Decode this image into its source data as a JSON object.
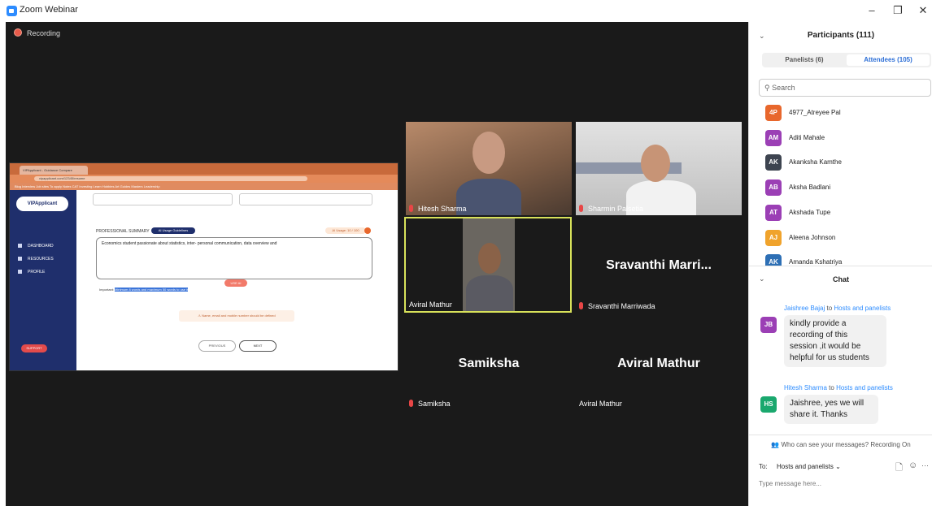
{
  "window": {
    "title": "Zoom Webinar",
    "controls": {
      "minimize": "–",
      "maximize": "❐",
      "close": "✕"
    }
  },
  "recording": {
    "label": "Recording"
  },
  "shared_screen": {
    "tab_title": "VIPApplicant - Guidance Compare",
    "url": "vipapplicant.com/12345/resume",
    "bookmarks": "Blog   Interview   Job sites   To apply   Notes   CAT   Investing   Learn   Hobbies   Art   Guides   Masters   Leadership",
    "sidebar_logo": "VIPApplicant",
    "sidebar_items": [
      "DASHBOARD",
      "RESOURCES",
      "PROFILE"
    ],
    "support_label": "SUPPORT",
    "section_label": "PROFESSIONAL SUMMARY",
    "ai_badge": "AI Usage Guidelines",
    "ai_usage": "AI Usage: 10 / 100",
    "textarea_text": "Economics student passionate about statistics, inter- personal communication, data overview and",
    "ai_button": "USE AI",
    "important_label": "Important:",
    "important_text": "Minimum 8 words and maximum 50 words to use it",
    "warning_text": "Name, email and mobile number should be defined",
    "prev_button": "PREVIOUS",
    "next_button": "NEXT"
  },
  "video_tiles": [
    {
      "name": "Hitesh Sharma",
      "muted": true
    },
    {
      "name": "Sharmin Palsetia",
      "muted": true
    },
    {
      "name": "Aviral Mathur",
      "muted": false
    },
    {
      "name": "Sravanthi Marriwada",
      "display": "Sravanthi  Marri...",
      "muted": true
    },
    {
      "name": "Samiksha",
      "display": "Samiksha",
      "muted": true
    },
    {
      "name": "Aviral Mathur",
      "display": "Aviral Mathur",
      "muted": false
    }
  ],
  "participants": {
    "header": "Participants (111)",
    "tab_panelists": "Panelists (6)",
    "tab_attendees": "Attendees (105)",
    "search_placeholder": "Search",
    "list": [
      {
        "initials": "4P",
        "name": "4977_Atreyee Pal",
        "color": "#e8672c"
      },
      {
        "initials": "AM",
        "name": "Aditi Mahale",
        "color": "#9b3fb5"
      },
      {
        "initials": "AK",
        "name": "Akanksha Kamthe",
        "color": "#3d4450"
      },
      {
        "initials": "AB",
        "name": "Aksha Badlani",
        "color": "#9b3fb5"
      },
      {
        "initials": "AT",
        "name": "Akshada Tupe",
        "color": "#9b3fb5"
      },
      {
        "initials": "AJ",
        "name": "Aleena Johnson",
        "color": "#f0a32c"
      },
      {
        "initials": "AK",
        "name": "Amanda Kshatriya",
        "color": "#2d6fb5"
      }
    ]
  },
  "chat": {
    "header": "Chat",
    "messages": [
      {
        "initials": "JB",
        "color": "#9b3fb5",
        "sender": "Jaishree Bajaj",
        "to_word": "to",
        "recipient": "Hosts and panelists",
        "lines": [
          "kindly provide a",
          "recording of this",
          "session ,it would be",
          "helpful for us students"
        ]
      },
      {
        "initials": "HS",
        "color": "#1aa86e",
        "sender": "Hitesh Sharma",
        "to_word": "to",
        "recipient": "Hosts and panelists",
        "lines": [
          "Jaishree, yes we will",
          "share it. Thanks"
        ]
      }
    ],
    "who_can_see": "Who can see your messages? Recording On",
    "to_label": "To:",
    "to_value": "Hosts and panelists",
    "placeholder": "Type message here...",
    "more": "···"
  }
}
